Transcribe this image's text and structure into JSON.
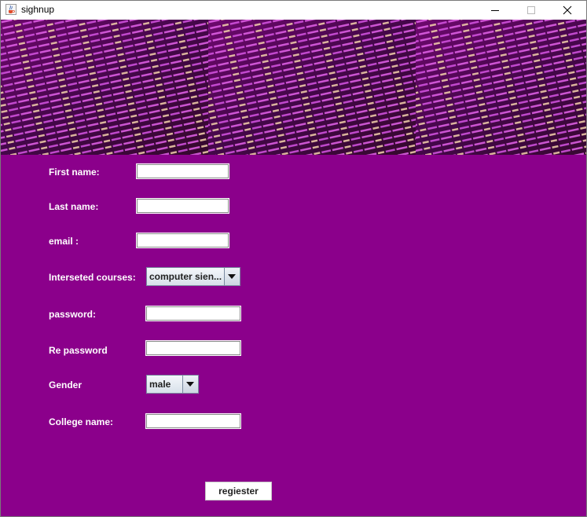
{
  "window": {
    "title": "sighnup",
    "icon": "java-cup-icon",
    "controls": [
      "minimize-icon",
      "maximize-icon",
      "close-icon"
    ]
  },
  "banner": {
    "description_icon": "code-screen-image",
    "tile_count": 3
  },
  "form": {
    "first_name_label": "First name:",
    "first_name_value": "",
    "last_name_label": "Last name:",
    "last_name_value": "",
    "email_label": "email :",
    "email_value": "",
    "courses_label": "Interseted courses:",
    "courses_selected": "computer sien...",
    "password_label": "password:",
    "password_value": "",
    "repassword_label": "Re password",
    "repassword_value": "",
    "gender_label": "Gender",
    "gender_selected": "male",
    "college_label": "College name:",
    "college_value": "",
    "register_button": "regiester"
  },
  "colors": {
    "background": "#8b008b",
    "label_text": "#ffffff"
  }
}
